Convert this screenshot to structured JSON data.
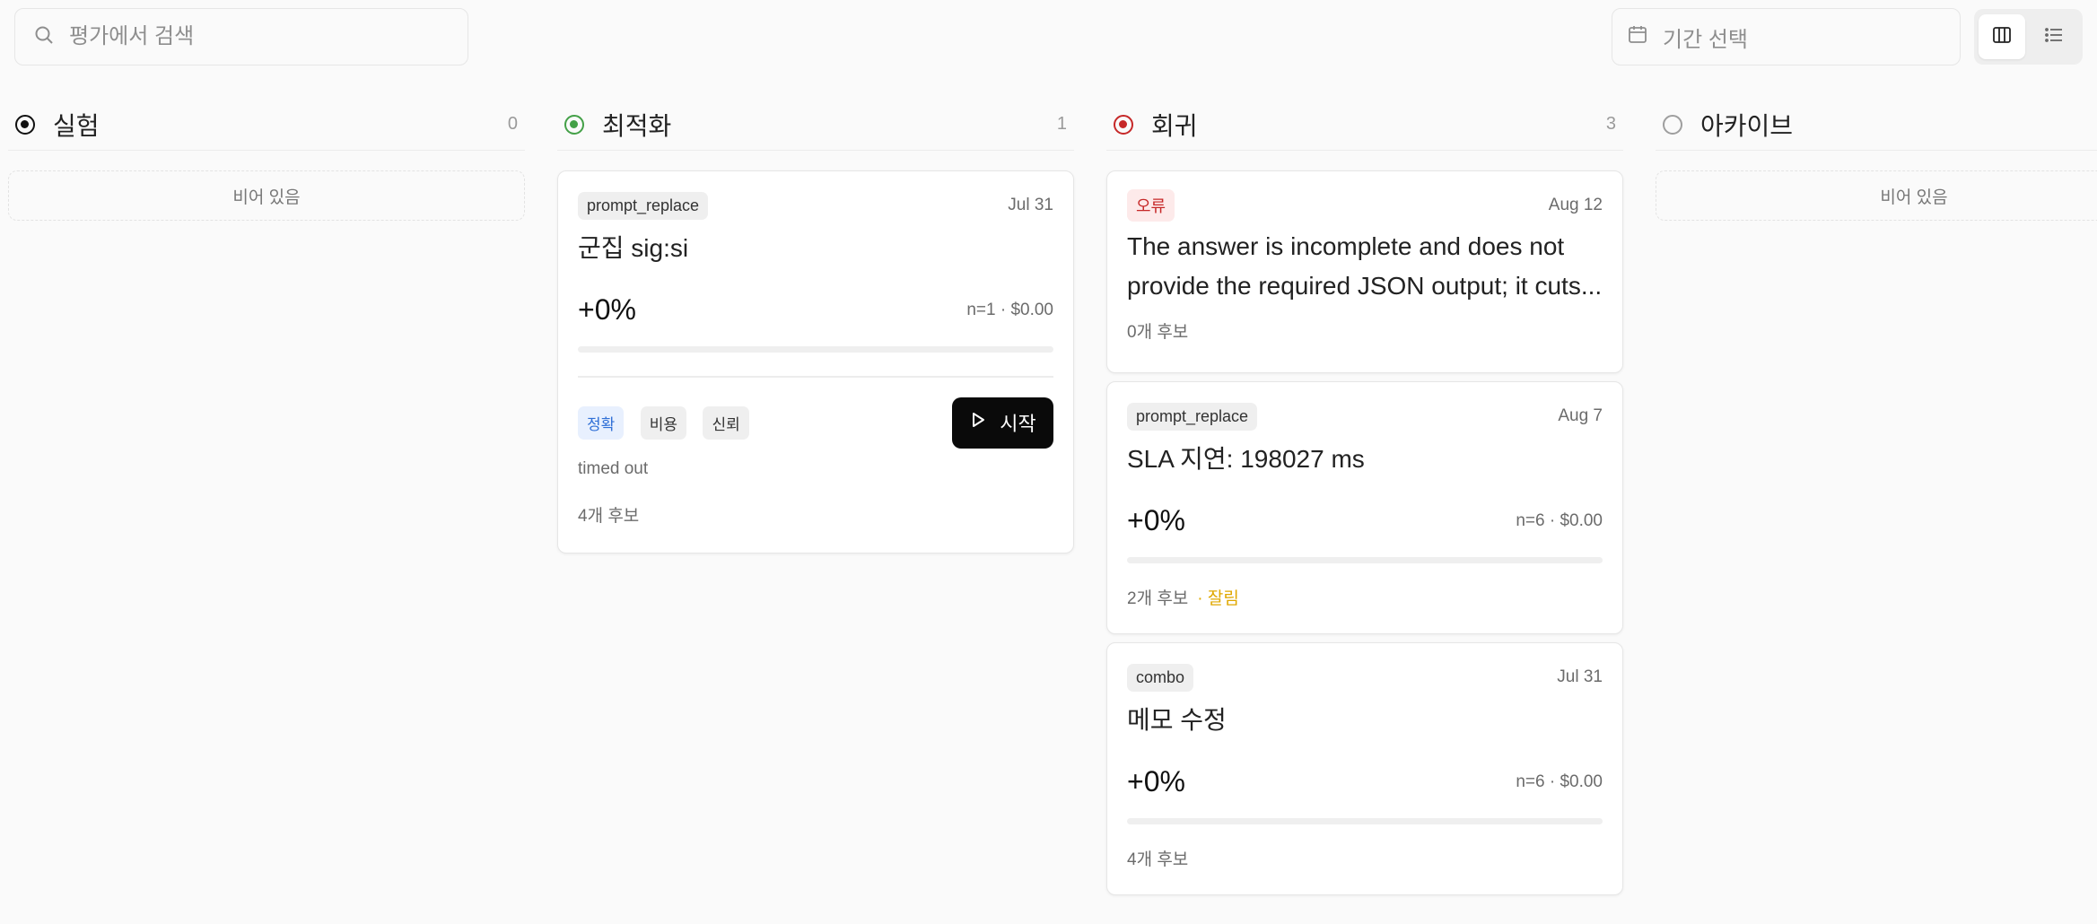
{
  "search": {
    "placeholder": "평가에서 검색"
  },
  "date_filter": {
    "placeholder": "기간 선택"
  },
  "view_toggle": {
    "board_icon": "columns-icon",
    "list_icon": "list-icon",
    "active": "board"
  },
  "columns": [
    {
      "title": "실험",
      "count": "0",
      "status_color": "#111111",
      "empty_text": "비어 있음"
    },
    {
      "title": "최적화",
      "count": "1",
      "status_color": "#43a047",
      "cards": [
        {
          "tag": "prompt_replace",
          "date": "Jul 31",
          "title": "군집 sig:si",
          "metric": "+0%",
          "meta": "n=1 · $0.00",
          "progress": 0,
          "chips": [
            "정확",
            "비용",
            "신뢰"
          ],
          "active_chip": "정확",
          "button_label": "시작",
          "status_text": "timed out",
          "footer": "4개 후보"
        }
      ]
    },
    {
      "title": "회귀",
      "count": "3",
      "status_color": "#c62828",
      "cards": [
        {
          "tag": "오류",
          "tag_type": "error",
          "date": "Aug 12",
          "title": "The answer is incomplete and does not provide the required JSON output; it cuts...",
          "footer": "0개 후보"
        },
        {
          "tag": "prompt_replace",
          "date": "Aug 7",
          "title": "SLA 지연: 198027 ms",
          "metric": "+0%",
          "meta": "n=6 · $0.00",
          "progress": 0,
          "footer": "2개 후보",
          "footer_warning": "· 잘림",
          "warning_color": "#e0a800"
        },
        {
          "tag": "combo",
          "date": "Jul 31",
          "title": "메모 수정",
          "metric": "+0%",
          "meta": "n=6 · $0.00",
          "progress": 0,
          "footer": "4개 후보"
        }
      ]
    },
    {
      "title": "아카이브",
      "count": "",
      "status_color": "#9e9e9e",
      "empty_text": "비어 있음"
    }
  ]
}
